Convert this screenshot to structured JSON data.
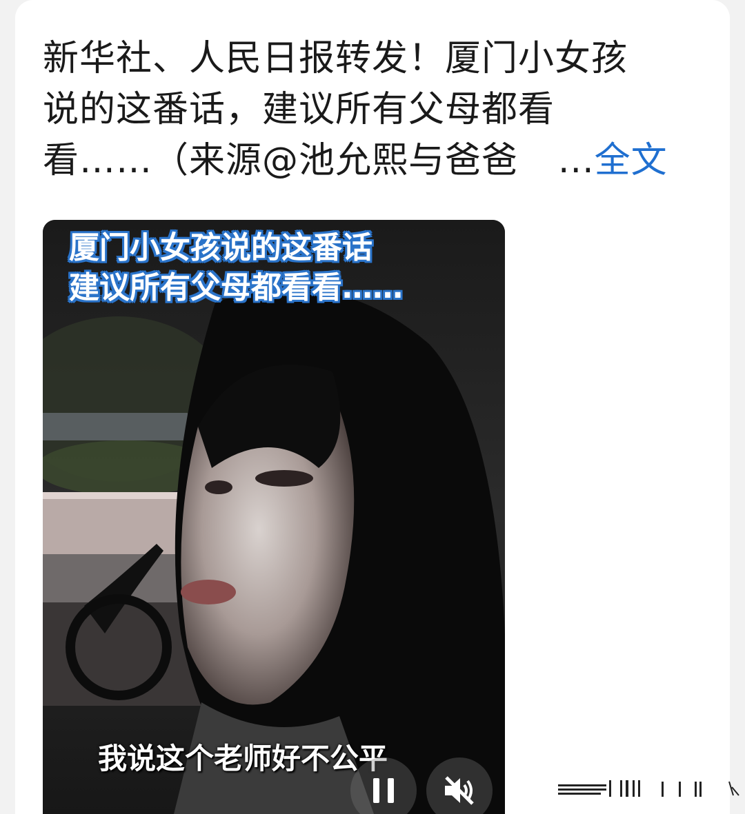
{
  "post": {
    "text_line1": "新华社、人民日报转发！厦门小女孩",
    "text_line2": "说的这番话，建议所有父母都看",
    "text_line3": "看……（来源@池允熙与爸爸",
    "ellipsis": "...",
    "more_label": "全文"
  },
  "video": {
    "overlay_title_line1": "厦门小女孩说的这番话",
    "overlay_title_line2": "建议所有父母都看看……",
    "subtitle": "我说这个老师好不公平",
    "pause_icon": "pause-icon",
    "mute_icon": "speaker-muted-icon"
  },
  "colors": {
    "link": "#1f6fd0",
    "caption_outline": "#2a73c9",
    "text": "#1a1a1a"
  }
}
